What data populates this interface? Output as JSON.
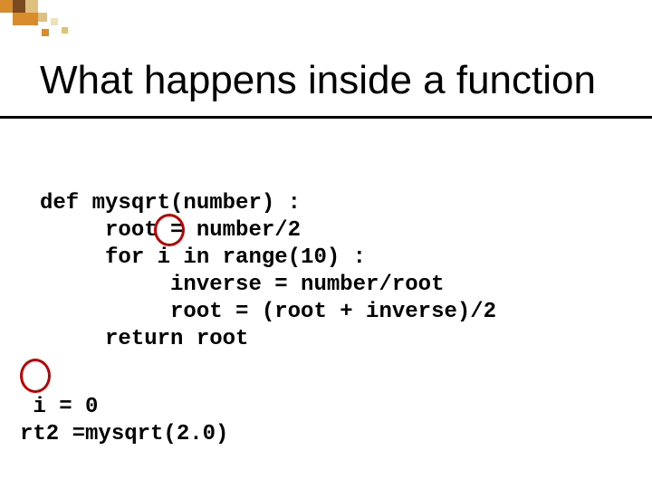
{
  "title": "What happens inside a function",
  "code": {
    "l1": "def mysqrt(number) :",
    "l2": "     root = number/2",
    "l3": "     for i in range(10) :",
    "l4": "          inverse = number/root",
    "l5": "          root = (root + inverse)/2",
    "l6": "     return root"
  },
  "code2": {
    "l1": " i = 0",
    "l2": "rt2 =mysqrt(2.0)"
  },
  "deco_colors": {
    "orange": "#d98c2b",
    "tan": "#e0c080",
    "brown": "#7a4a20",
    "lt": "#f0e0b8"
  }
}
